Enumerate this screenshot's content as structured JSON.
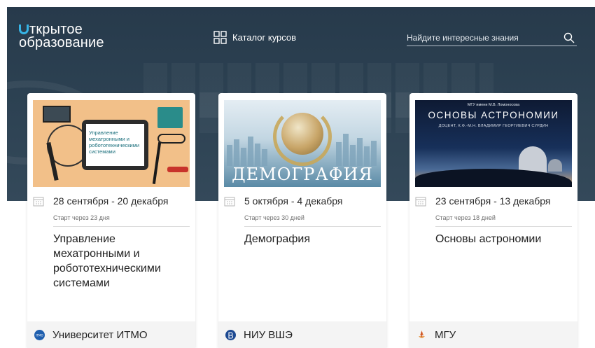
{
  "header": {
    "logo_line1": "ткрытое",
    "logo_line2": "образование",
    "catalog_label": "Каталог курсов",
    "search_placeholder": "Найдите интересные знания"
  },
  "courses": [
    {
      "image_text": "Управление мехатронными и робототехническими системами",
      "date": "28 сентября - 20 декабря",
      "start": "Старт через 23 дня",
      "title": "Управление мехатронными и робототехническими системами",
      "university": "Университет ИТМО",
      "university_color": "#1f5fae"
    },
    {
      "image_text": "ДЕМОГРАФИЯ",
      "date": "5 октября - 4 декабря",
      "start": "Старт через 30 дней",
      "title": "Демография",
      "university": "НИУ ВШЭ",
      "university_color": "#1d4a92"
    },
    {
      "image_top": "МГУ имени М.В. Ломоносова",
      "image_text": "ОСНОВЫ АСТРОНОМИИ",
      "image_sub": "ДОЦЕНТ, К.Ф.-М.Н. ВЛАДИМИР ГЕОРГИЕВИЧ СУРДИН",
      "date": "23 сентября - 13 декабря",
      "start": "Старт через 18 дней",
      "title": "Основы астрономии",
      "university": "МГУ",
      "university_color": "#e0703a"
    }
  ],
  "colors": {
    "header_bg": "#273a4b",
    "logo_accent": "#36b4e6"
  }
}
